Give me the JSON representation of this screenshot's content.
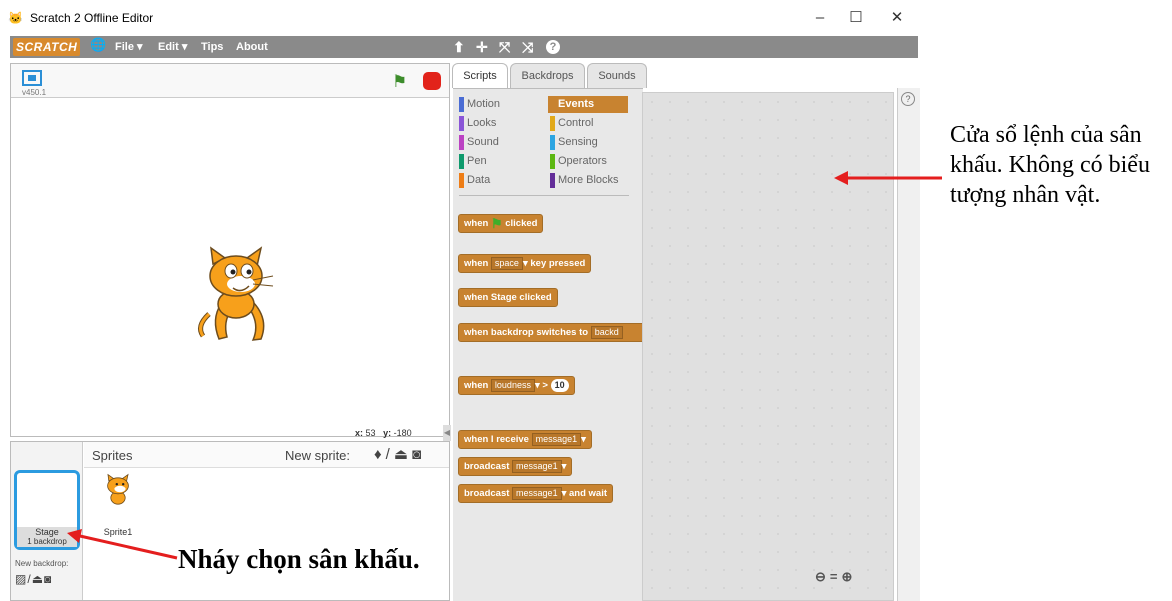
{
  "window": {
    "title": "Scratch 2 Offline Editor",
    "minimize": "–",
    "maximize": "☐",
    "close": "✕"
  },
  "menubar": {
    "logo": "SCRATCH",
    "globe": "🌐",
    "file": "File ▾",
    "edit": "Edit ▾",
    "tips": "Tips",
    "about": "About",
    "tools": [
      "⬆",
      "✛",
      "⤧",
      "⤨",
      "?"
    ]
  },
  "stage": {
    "version": "v450.1",
    "coords": {
      "x_label": "x:",
      "x": "53",
      "y_label": "y:",
      "y": "-180"
    }
  },
  "sprite_pane": {
    "stage_label": "Stage",
    "stage_sub": "1 backdrop",
    "new_backdrop": "New backdrop:",
    "sprites_label": "Sprites",
    "new_sprite_label": "New sprite:",
    "sprite_name": "Sprite1"
  },
  "tabs": [
    "Scripts",
    "Backdrops",
    "Sounds"
  ],
  "categories": [
    {
      "label": "Motion",
      "color": "#4a6cd4"
    },
    {
      "label": "Looks",
      "color": "#8a55d7"
    },
    {
      "label": "Sound",
      "color": "#bb42c3"
    },
    {
      "label": "Pen",
      "color": "#0e9a6c"
    },
    {
      "label": "Data",
      "color": "#ee7d16"
    },
    {
      "label": "Events",
      "color": "#c88330"
    },
    {
      "label": "Control",
      "color": "#e1a91a"
    },
    {
      "label": "Sensing",
      "color": "#2ca5e2"
    },
    {
      "label": "Operators",
      "color": "#5cb712"
    },
    {
      "label": "More Blocks",
      "color": "#632d99"
    }
  ],
  "blocks": {
    "when": "when",
    "clicked": "clicked",
    "space": "space",
    "key_pressed": "key pressed",
    "stage_clicked": "when Stage clicked",
    "backdrop_switches": "when backdrop switches to",
    "backdrop_dd": "backd",
    "loudness_dd": "loudness",
    "gt": ">",
    "ten": "10",
    "when_receive": "when I receive",
    "message1": "message1",
    "broadcast": "broadcast",
    "and_wait": "and wait"
  },
  "zoom": {
    "out": "🔍",
    "reset": "=",
    "in": "🔍"
  },
  "annotations": {
    "right": "Cửa sổ lệnh của sân khấu. Không có biểu tượng nhân vật.",
    "bottom": "Nháy chọn sân khấu."
  }
}
